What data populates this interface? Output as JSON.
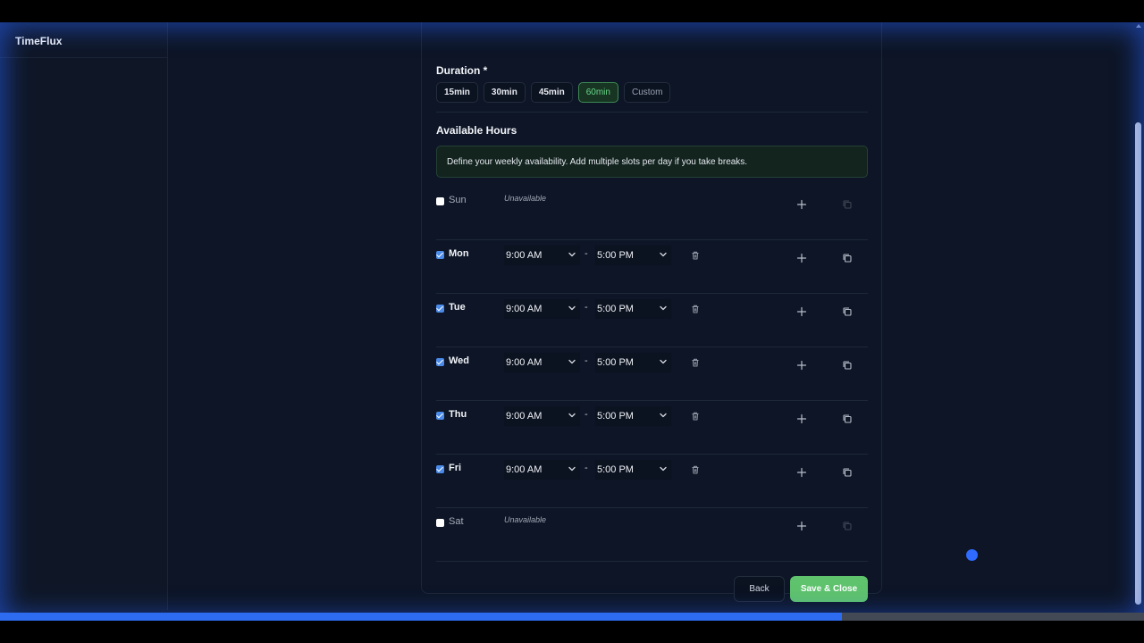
{
  "app": {
    "brand": "TimeFlux"
  },
  "duration": {
    "label": "Duration *",
    "options": [
      {
        "label": "15min",
        "selected": false
      },
      {
        "label": "30min",
        "selected": false
      },
      {
        "label": "45min",
        "selected": false
      },
      {
        "label": "60min",
        "selected": true
      },
      {
        "label": "Custom",
        "selected": false
      }
    ]
  },
  "hours": {
    "label": "Available Hours",
    "info": "Define your weekly availability. Add multiple slots per day if you take breaks.",
    "unavailable_text": "Unavailable",
    "separator": "-",
    "days": [
      {
        "name": "Sun",
        "enabled": false
      },
      {
        "name": "Mon",
        "enabled": true,
        "start": "9:00 AM",
        "end": "5:00 PM"
      },
      {
        "name": "Tue",
        "enabled": true,
        "start": "9:00 AM",
        "end": "5:00 PM"
      },
      {
        "name": "Wed",
        "enabled": true,
        "start": "9:00 AM",
        "end": "5:00 PM"
      },
      {
        "name": "Thu",
        "enabled": true,
        "start": "9:00 AM",
        "end": "5:00 PM"
      },
      {
        "name": "Fri",
        "enabled": true,
        "start": "9:00 AM",
        "end": "5:00 PM"
      },
      {
        "name": "Sat",
        "enabled": false
      }
    ]
  },
  "footer": {
    "back_label": "Back",
    "save_label": "Save & Close"
  },
  "video": {
    "progress_fraction": 0.736
  },
  "colors": {
    "accent_green": "#5fc36d",
    "accent_blue": "#2d6bf0",
    "checkbox_blue": "#4a8ae8"
  },
  "icons": {
    "add": "plus-icon",
    "copy": "copy-icon",
    "delete": "trash-icon",
    "dropdown": "chevron-down-icon"
  }
}
